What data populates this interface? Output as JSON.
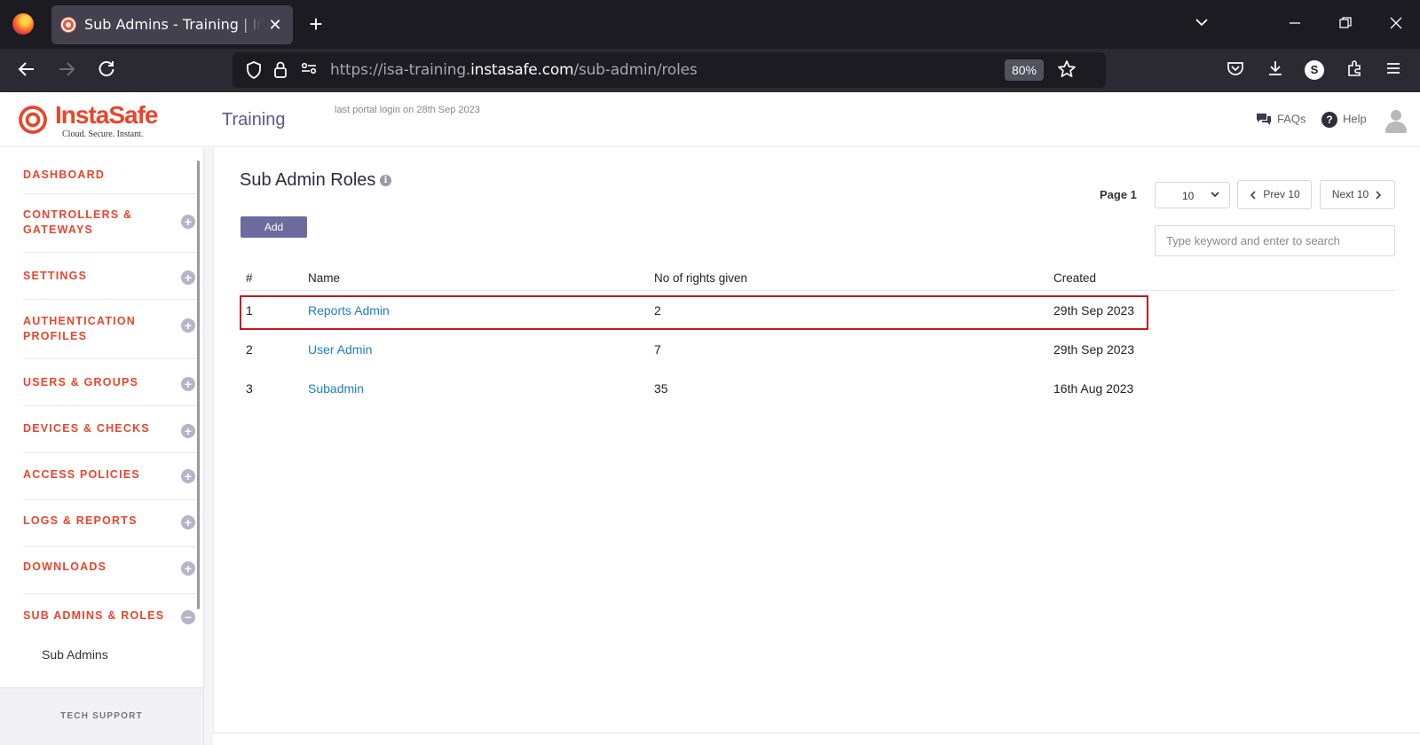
{
  "browser": {
    "tab_title": "Sub Admins - Training | InstaSafe",
    "tab_close": "✕",
    "new_tab": "+",
    "url_prefix": "https://isa-training.",
    "url_host": "instasafe.com",
    "url_path": "/sub-admin/roles",
    "zoom": "80%",
    "profile_initial": "S"
  },
  "header": {
    "logo_word": "InstaSafe",
    "logo_tagline": "Cloud. Secure. Instant.",
    "portal_name": "Training",
    "last_login": "last portal login on 28th Sep 2023",
    "faqs": "FAQs",
    "help": "Help"
  },
  "sidebar": {
    "items": [
      {
        "label": "DASHBOARD",
        "expandable": false
      },
      {
        "label": "CONTROLLERS & GATEWAYS",
        "expandable": true,
        "icon": "plus"
      },
      {
        "label": "SETTINGS",
        "expandable": true,
        "icon": "plus"
      },
      {
        "label": "AUTHENTICATION PROFILES",
        "expandable": true,
        "icon": "plus"
      },
      {
        "label": "USERS & GROUPS",
        "expandable": true,
        "icon": "plus"
      },
      {
        "label": "DEVICES & CHECKS",
        "expandable": true,
        "icon": "plus"
      },
      {
        "label": "ACCESS POLICIES",
        "expandable": true,
        "icon": "plus"
      },
      {
        "label": "LOGS & REPORTS",
        "expandable": true,
        "icon": "plus"
      },
      {
        "label": "DOWNLOADS",
        "expandable": true,
        "icon": "plus"
      },
      {
        "label": "SUB ADMINS & ROLES",
        "expandable": true,
        "icon": "minus"
      }
    ],
    "sub_item": "Sub Admins",
    "tech_support": "TECH SUPPORT"
  },
  "main": {
    "title": "Sub Admin Roles",
    "add_button": "Add",
    "page_label": "Page 1",
    "per_page": "10",
    "prev_button": "Prev 10",
    "next_button": "Next 10",
    "search_placeholder": "Type keyword and enter to search",
    "columns": [
      "#",
      "Name",
      "No of rights given",
      "Created"
    ],
    "rows": [
      {
        "num": "1",
        "name": "Reports Admin",
        "rights": "2",
        "created": "29th Sep 2023",
        "highlighted": true
      },
      {
        "num": "2",
        "name": "User Admin",
        "rights": "7",
        "created": "29th Sep 2023",
        "highlighted": false
      },
      {
        "num": "3",
        "name": "Subadmin",
        "rights": "35",
        "created": "16th Aug 2023",
        "highlighted": false
      }
    ]
  },
  "colors": {
    "brand_orange": "#e8452c",
    "accent_purple": "#6d6a9e",
    "link_blue": "#1a7fc1",
    "highlight_red": "#c8161d"
  }
}
